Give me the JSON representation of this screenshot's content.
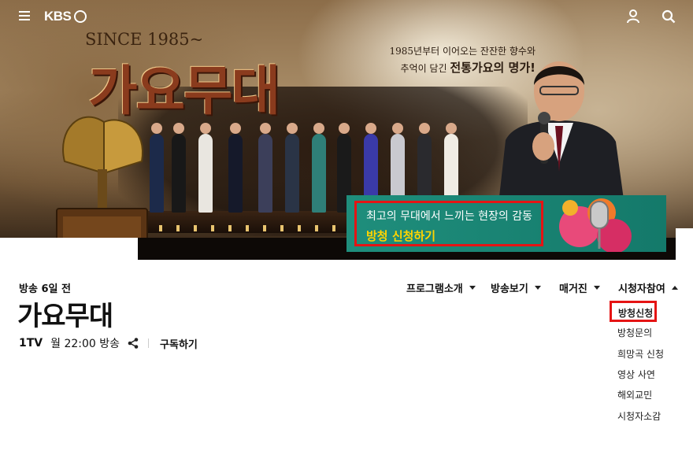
{
  "header": {
    "logo_text": "KBS"
  },
  "hero": {
    "since": "SINCE 1985~",
    "title": "가요무대",
    "tagline_line1": "1985년부터 이어오는 잔잔한 향수와",
    "tagline_line2_prefix": "추억이 담긴 ",
    "tagline_line2_bold": "전통가요의 명가!",
    "promo_line1": "최고의 무대에서 느끼는 현장의 감동",
    "promo_line2": "방청 신청하기"
  },
  "program": {
    "aired_ago": "방송 6일 전",
    "title": "가요무대",
    "channel": "1TV",
    "schedule": "월 22:00 방송",
    "subscribe_label": "구독하기"
  },
  "nav": {
    "items": [
      {
        "label": "프로그램소개"
      },
      {
        "label": "방송보기"
      },
      {
        "label": "매거진"
      },
      {
        "label": "시청자참여"
      }
    ]
  },
  "dropdown": {
    "items": [
      {
        "label": "방청신청"
      },
      {
        "label": "방청문의"
      },
      {
        "label": "희망곡 신청"
      },
      {
        "label": "영상 사연"
      },
      {
        "label": "해외교민"
      },
      {
        "label": "시청자소감"
      }
    ]
  },
  "colors": {
    "highlight": "#e51414",
    "promo_green": "#1f8e7c",
    "promo_yellow": "#ffd400"
  },
  "icons": [
    "menu-icon",
    "user-icon",
    "search-icon",
    "share-icon",
    "chevron-down-icon",
    "chevron-up-icon"
  ]
}
